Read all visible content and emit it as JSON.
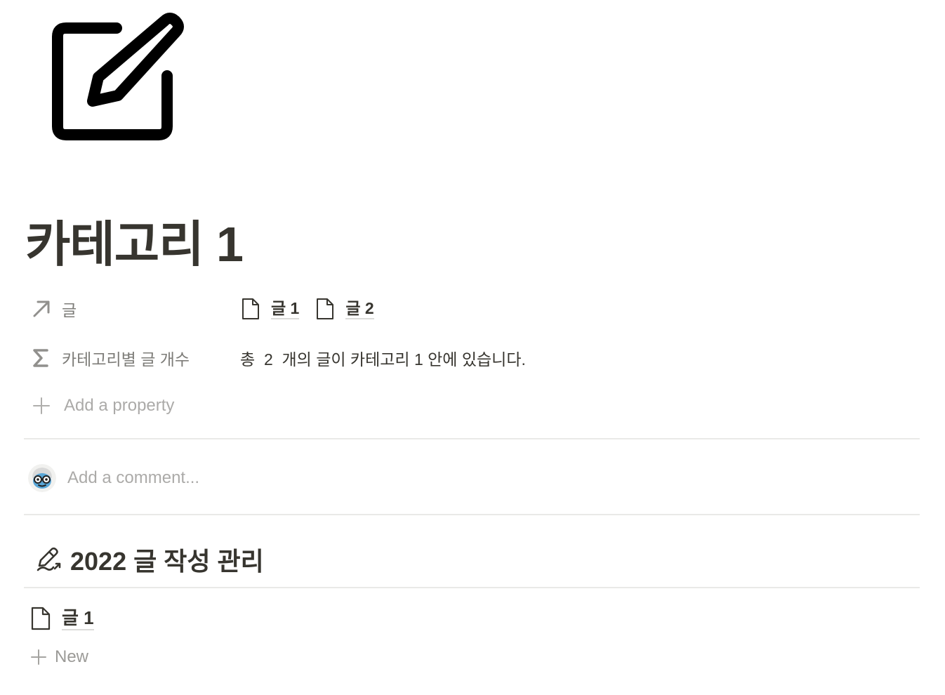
{
  "page": {
    "icon": "edit-pencil-square-icon",
    "title": "카테고리 1"
  },
  "properties": [
    {
      "icon": "relation-arrow-icon",
      "name": "글",
      "type": "relation",
      "values": [
        "글 1",
        "글 2"
      ]
    },
    {
      "icon": "formula-sigma-icon",
      "name": "카테고리별 글 개수",
      "type": "formula",
      "value": "총  2  개의 글이 카테고리 1 안에 있습니다."
    }
  ],
  "add_property": {
    "icon": "plus-icon",
    "label": "Add a property"
  },
  "comment": {
    "avatar": "user-avatar",
    "placeholder": "Add a comment..."
  },
  "linked_database": {
    "icon": "signature-pen-icon",
    "title": "2022 글 작성 관리",
    "items": [
      "글 1"
    ],
    "new_label": "New"
  },
  "colors": {
    "text": "#37352f",
    "muted": "rgba(55,53,47,0.65)",
    "placeholder": "rgba(55,53,47,0.42)",
    "divider": "#e9e9e7"
  }
}
